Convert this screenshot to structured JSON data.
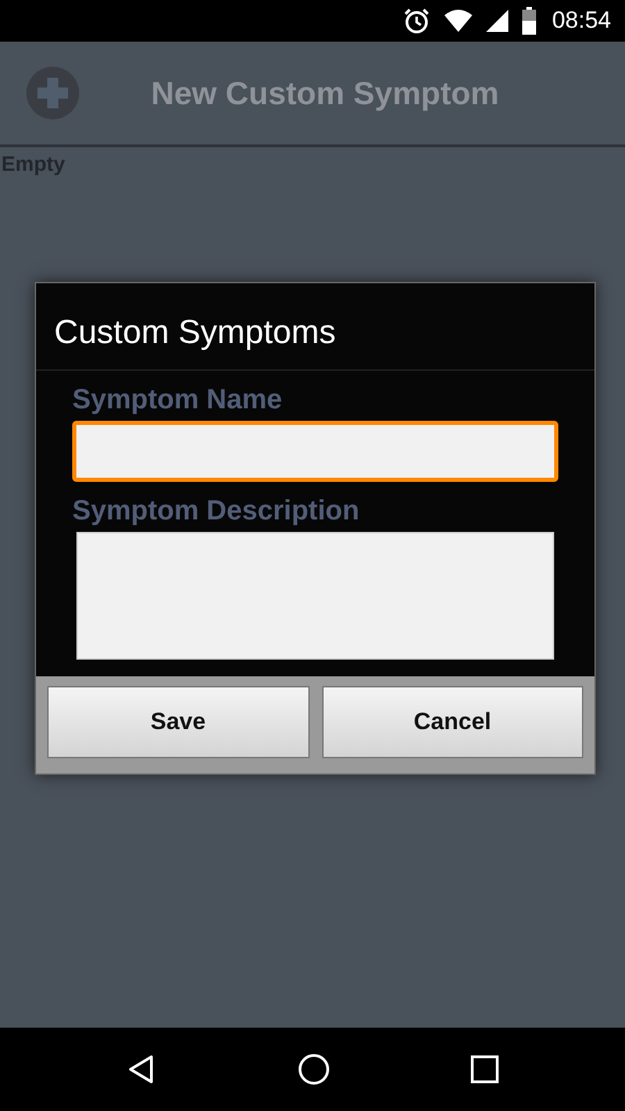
{
  "status_bar": {
    "time": "08:54"
  },
  "header": {
    "title": "New Custom Symptom"
  },
  "list": {
    "empty_text": "Empty"
  },
  "dialog": {
    "title": "Custom Symptoms",
    "fields": [
      {
        "label": "Symptom Name",
        "kind": "single",
        "focused": true
      },
      {
        "label": "Symptom Description",
        "kind": "multi",
        "focused": false
      }
    ],
    "buttons": [
      "Save",
      "Cancel"
    ]
  }
}
